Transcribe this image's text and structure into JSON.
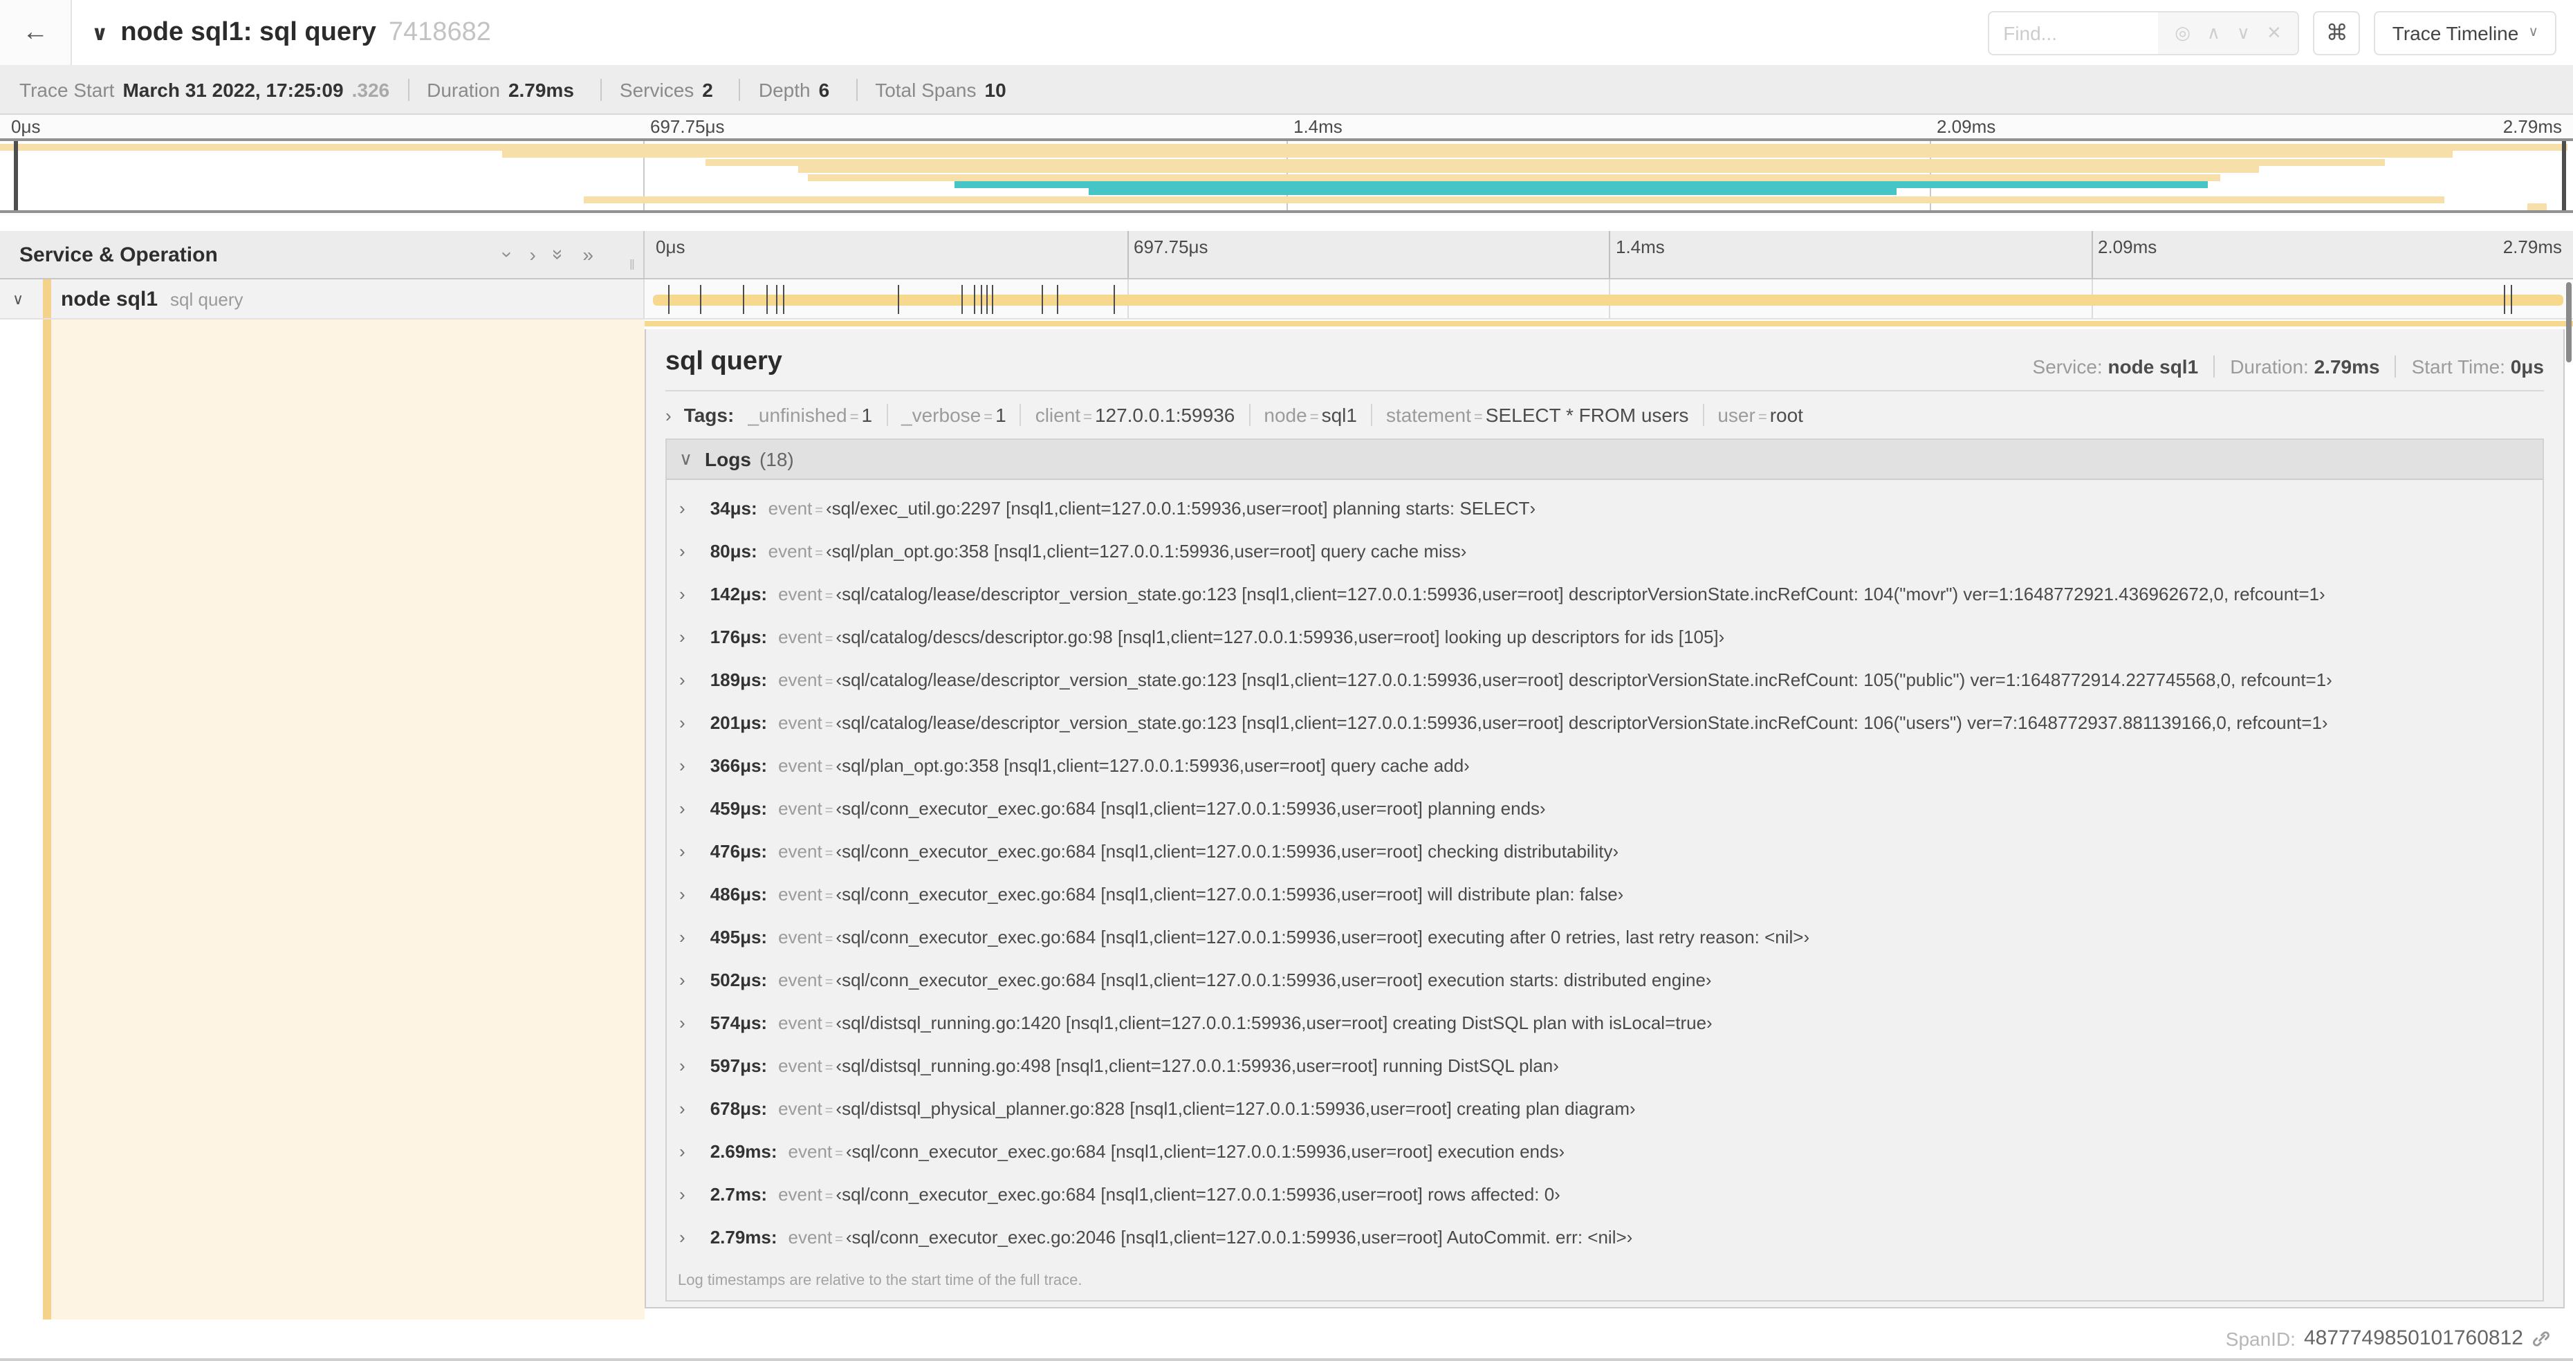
{
  "header": {
    "back_icon": "←",
    "collapse_chevron": "∨",
    "title": "node sql1: sql query",
    "trace_id": "7418682",
    "find_placeholder": "Find...",
    "find_icons": [
      {
        "name": "locate-icon",
        "glyph": "◎"
      },
      {
        "name": "prev-result-icon",
        "glyph": "∧"
      },
      {
        "name": "next-result-icon",
        "glyph": "∨"
      },
      {
        "name": "clear-search-icon",
        "glyph": "✕"
      }
    ],
    "shortcut_icon": "⌘",
    "view_select_label": "Trace Timeline",
    "view_select_chevron": "∨"
  },
  "trace_info": {
    "items": [
      {
        "label": "Trace Start",
        "value": "March 31 2022, 17:25:09",
        "suffix": ".326"
      },
      {
        "label": "Duration",
        "value": "2.79ms",
        "suffix": ""
      },
      {
        "label": "Services",
        "value": "2",
        "suffix": ""
      },
      {
        "label": "Depth",
        "value": "6",
        "suffix": ""
      },
      {
        "label": "Total Spans",
        "value": "10",
        "suffix": ""
      }
    ]
  },
  "ticks": [
    "0μs",
    "697.75μs",
    "1.4ms",
    "2.09ms",
    "2.79ms"
  ],
  "colors": {
    "span_tan": "#f7d88f",
    "span_teal": "#45c5c5",
    "detail_cream": "#fdf4e4"
  },
  "minimap": {
    "rows": [
      {
        "color": "tan",
        "start": 0.0,
        "end": 0.998
      },
      {
        "color": "tan",
        "start": 0.195,
        "end": 0.953
      },
      {
        "color": "tan",
        "start": 0.274,
        "end": 0.927
      },
      {
        "color": "tan",
        "start": 0.31,
        "end": 0.878
      },
      {
        "color": "tan",
        "start": 0.314,
        "end": 0.863
      },
      {
        "color": "teal",
        "start": 0.371,
        "end": 0.858
      },
      {
        "color": "teal",
        "start": 0.423,
        "end": 0.737
      },
      {
        "color": "tan",
        "start": 0.227,
        "end": 0.95
      },
      {
        "color": "tan",
        "start": 0.982,
        "end": 0.99
      }
    ]
  },
  "timeline": {
    "header_title": "Service & Operation",
    "collapse_icons": [
      {
        "name": "collapse-one-icon",
        "glyph": "›",
        "rotate": true
      },
      {
        "name": "expand-one-icon",
        "glyph": "›",
        "rotate": false
      },
      {
        "name": "collapse-all-icon",
        "glyph": "»",
        "rotate": true
      },
      {
        "name": "expand-all-icon",
        "glyph": "»",
        "rotate": false
      }
    ],
    "grip": "‖"
  },
  "span_row": {
    "chevron": "∨",
    "service": "node sql1",
    "operation": "sql query"
  },
  "detail": {
    "title": "sql query",
    "meta": [
      {
        "label": "Service:",
        "value": "node sql1"
      },
      {
        "label": "Duration:",
        "value": "2.79ms"
      },
      {
        "label": "Start Time:",
        "value": "0μs"
      }
    ],
    "accordian_chevron": "›",
    "logs_chevron": "∨",
    "tags_label": "Tags:",
    "tags": [
      {
        "key": "_unfinished",
        "value": "1"
      },
      {
        "key": "_verbose",
        "value": "1"
      },
      {
        "key": "client",
        "value": "127.0.0.1:59936"
      },
      {
        "key": "node",
        "value": "sql1"
      },
      {
        "key": "statement",
        "value": "SELECT * FROM users"
      },
      {
        "key": "user",
        "value": "root"
      }
    ],
    "logs_title": "Logs",
    "logs_count": "(18)",
    "log_field": "event",
    "logs": [
      {
        "time": "34μs:",
        "frac": 0.012,
        "value": "‹sql/exec_util.go:2297 [nsql1,client=127.0.0.1:59936,user=root] planning starts: SELECT›"
      },
      {
        "time": "80μs:",
        "frac": 0.029,
        "value": "‹sql/plan_opt.go:358 [nsql1,client=127.0.0.1:59936,user=root] query cache miss›"
      },
      {
        "time": "142μs:",
        "frac": 0.051,
        "value": "‹sql/catalog/lease/descriptor_version_state.go:123 [nsql1,client=127.0.0.1:59936,user=root] descriptorVersionState.incRefCount: 104(\"movr\") ver=1:1648772921.436962672,0, refcount=1›"
      },
      {
        "time": "176μs:",
        "frac": 0.063,
        "value": "‹sql/catalog/descs/descriptor.go:98 [nsql1,client=127.0.0.1:59936,user=root] looking up descriptors for ids [105]›"
      },
      {
        "time": "189μs:",
        "frac": 0.068,
        "value": "‹sql/catalog/lease/descriptor_version_state.go:123 [nsql1,client=127.0.0.1:59936,user=root] descriptorVersionState.incRefCount: 105(\"public\") ver=1:1648772914.227745568,0, refcount=1›"
      },
      {
        "time": "201μs:",
        "frac": 0.072,
        "value": "‹sql/catalog/lease/descriptor_version_state.go:123 [nsql1,client=127.0.0.1:59936,user=root] descriptorVersionState.incRefCount: 106(\"users\") ver=7:1648772937.881139166,0, refcount=1›"
      },
      {
        "time": "366μs:",
        "frac": 0.131,
        "value": "‹sql/plan_opt.go:358 [nsql1,client=127.0.0.1:59936,user=root] query cache add›"
      },
      {
        "time": "459μs:",
        "frac": 0.164,
        "value": "‹sql/conn_executor_exec.go:684 [nsql1,client=127.0.0.1:59936,user=root] planning ends›"
      },
      {
        "time": "476μs:",
        "frac": 0.171,
        "value": "‹sql/conn_executor_exec.go:684 [nsql1,client=127.0.0.1:59936,user=root] checking distributability›"
      },
      {
        "time": "486μs:",
        "frac": 0.174,
        "value": "‹sql/conn_executor_exec.go:684 [nsql1,client=127.0.0.1:59936,user=root] will distribute plan: false›"
      },
      {
        "time": "495μs:",
        "frac": 0.177,
        "value": "‹sql/conn_executor_exec.go:684 [nsql1,client=127.0.0.1:59936,user=root] executing after 0 retries, last retry reason: <nil>›"
      },
      {
        "time": "502μs:",
        "frac": 0.18,
        "value": "‹sql/conn_executor_exec.go:684 [nsql1,client=127.0.0.1:59936,user=root] execution starts: distributed engine›"
      },
      {
        "time": "574μs:",
        "frac": 0.206,
        "value": "‹sql/distsql_running.go:1420 [nsql1,client=127.0.0.1:59936,user=root] creating DistSQL plan with isLocal=true›"
      },
      {
        "time": "597μs:",
        "frac": 0.214,
        "value": "‹sql/distsql_running.go:498 [nsql1,client=127.0.0.1:59936,user=root] running DistSQL plan›"
      },
      {
        "time": "678μs:",
        "frac": 0.243,
        "value": "‹sql/distsql_physical_planner.go:828 [nsql1,client=127.0.0.1:59936,user=root] creating plan diagram›"
      },
      {
        "time": "2.69ms:",
        "frac": 0.964,
        "value": "‹sql/conn_executor_exec.go:684 [nsql1,client=127.0.0.1:59936,user=root] execution ends›"
      },
      {
        "time": "2.7ms:",
        "frac": 0.968,
        "value": "‹sql/conn_executor_exec.go:684 [nsql1,client=127.0.0.1:59936,user=root] rows affected: 0›"
      },
      {
        "time": "2.79ms:",
        "frac": 0.997,
        "value": "‹sql/conn_executor_exec.go:2046 [nsql1,client=127.0.0.1:59936,user=root] AutoCommit. err: <nil>›"
      }
    ],
    "logs_footer": "Log timestamps are relative to the start time of the full trace.",
    "spanid_label": "SpanID:",
    "spanid_value": "4877749850101760812"
  }
}
